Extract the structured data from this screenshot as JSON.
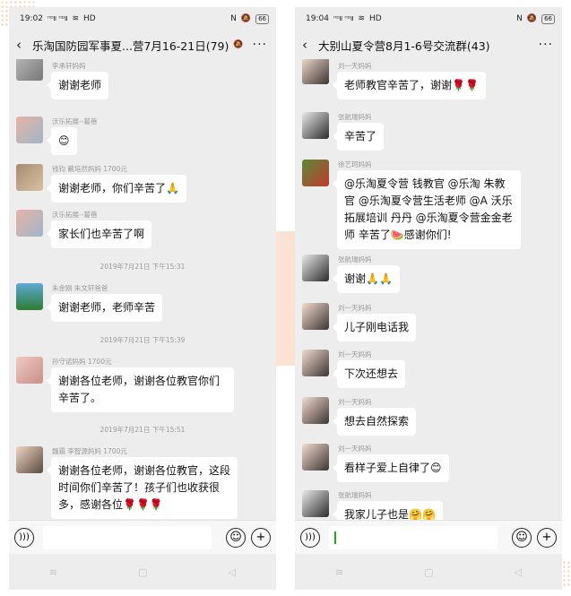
{
  "left": {
    "status": {
      "time": "19:02",
      "signal": "ᴴᴰⅡ ᴴᴰⅡ",
      "network": "HD",
      "right_icons": "N",
      "battery": "66"
    },
    "header": {
      "title": "乐淘国防园军事夏...营7月16-21日(79)"
    },
    "messages": [
      {
        "sender": "李承轩妈妈",
        "text": "谢谢老师"
      },
      {
        "sender": "沃乐拓展--葛蓓",
        "text": "😊"
      },
      {
        "sender": "钱钧 戴培然妈妈 1700元",
        "text": "谢谢老师，你们辛苦了🙏"
      },
      {
        "sender": "沃乐拓展--葛蓓",
        "text": "家长们也辛苦了啊"
      },
      {
        "sender": "朱金刚 朱文轩爸爸",
        "text": "谢谢老师，老师辛苦"
      },
      {
        "sender": "孙守诺妈妈 1700元",
        "text": "谢谢各位老师，谢谢各位教官你们辛苦了。"
      },
      {
        "sender": "魏霜 李智源妈妈 1700元",
        "text": "谢谢各位老师，谢谢各位教官，这段时间你们辛苦了！孩子们也收获很多，感谢各位🌹🌹🌹"
      }
    ],
    "timestamps": [
      "2019年7月21日 下午15:31",
      "2019年7月21日 下午15:39",
      "2019年7月21日 下午15:51"
    ]
  },
  "right": {
    "status": {
      "time": "19:04",
      "signal": "ᴴᴰⅡ ᴴᴰⅡ",
      "network": "HD",
      "right_icons": "N",
      "battery": "66"
    },
    "header": {
      "title": "大别山夏令营8月1-6号交流群(43)"
    },
    "messages": [
      {
        "sender": "刘一天妈妈",
        "text": "老师教官辛苦了，谢谢🌹🌹"
      },
      {
        "sender": "张航瑞妈妈",
        "text": "辛苦了"
      },
      {
        "sender": "徐艺珂妈妈",
        "text": "@乐淘夏令营  钱教官 @乐淘 朱教官 @乐淘夏令营生活老师 @A 沃乐拓展培训 丹丹 @乐淘夏令营金金老师  辛苦了🍉感谢你们!"
      },
      {
        "sender": "张航瑞妈妈",
        "text": "谢谢🙏🙏"
      },
      {
        "sender": "刘一天妈妈",
        "text": "儿子刚电话我"
      },
      {
        "sender": "刘一天妈妈",
        "text": "下次还想去"
      },
      {
        "sender": "刘一天妈妈",
        "text": "想去自然探索"
      },
      {
        "sender": "刘一天妈妈",
        "text": "看样子爱上自律了😊"
      },
      {
        "sender": "张航瑞妈妈",
        "text": "我家儿子也是🤗🤗"
      }
    ]
  },
  "icons": {
    "back": "chevron-left-icon",
    "more": "more-icon",
    "voice": "voice-icon",
    "emoji": "emoji-icon",
    "plus": "plus-icon",
    "nav_menu": "menu-icon",
    "nav_home": "home-icon",
    "nav_back": "back-triangle-icon",
    "mute": "bell-mute-icon"
  },
  "colors": {
    "chat_bg": "#ededed",
    "bubble": "#ffffff",
    "caret": "#1aad19",
    "deco": "#f4c8a8"
  }
}
